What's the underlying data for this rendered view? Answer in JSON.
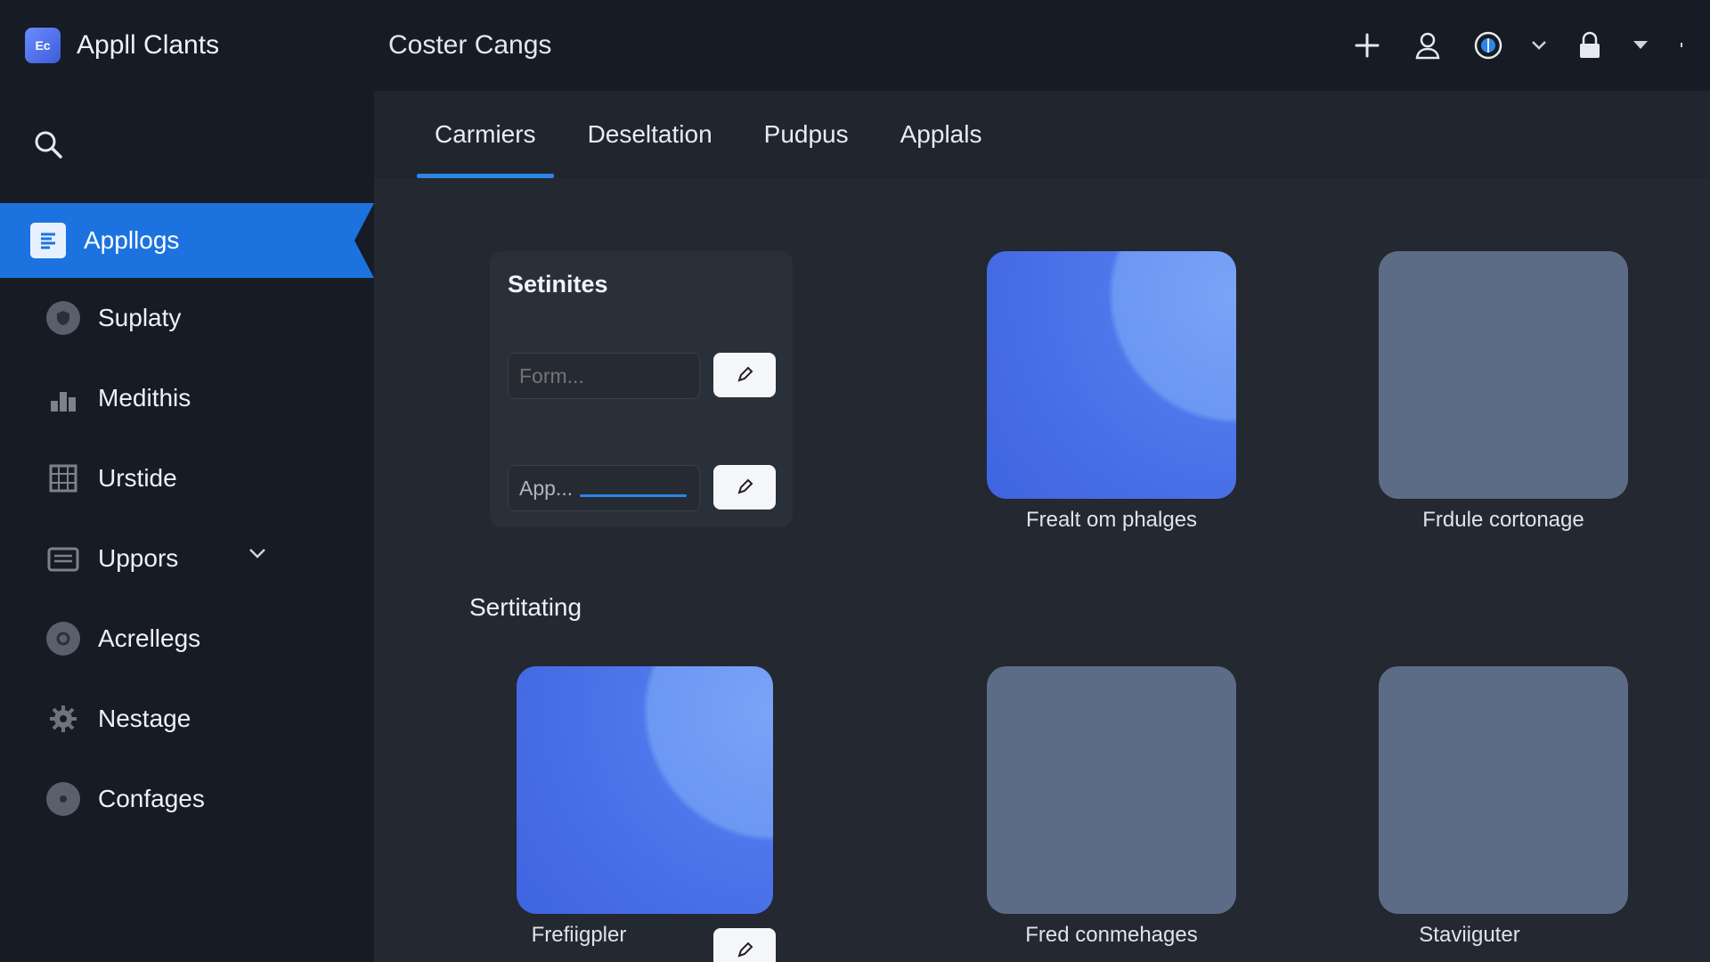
{
  "app": {
    "title": "Appll Clants",
    "logo_text": "Ec",
    "page_title": "Coster Cangs"
  },
  "colors": {
    "accent": "#1c73df",
    "sidebar_bg": "#161b24",
    "main_bg": "#232831",
    "tile_blue": "#4f76ea",
    "tile_grey": "#5d6c86"
  },
  "top_actions": [
    {
      "name": "add-icon"
    },
    {
      "name": "user-icon"
    },
    {
      "name": "globe-icon"
    },
    {
      "name": "lock-icon"
    }
  ],
  "sidebar": {
    "search_icon": "search-icon",
    "items": [
      {
        "label": "Appllogs",
        "icon": "document-icon",
        "active": true
      },
      {
        "label": "Suplaty",
        "icon": "shield-icon"
      },
      {
        "label": "Medithis",
        "icon": "chart-icon"
      },
      {
        "label": "Urstide",
        "icon": "grid-icon"
      },
      {
        "label": "Uppors",
        "icon": "folder-icon",
        "has_chevron": true
      },
      {
        "label": "Acrellegs",
        "icon": "circle-icon"
      },
      {
        "label": "Nestage",
        "icon": "gear-icon"
      },
      {
        "label": "Confages",
        "icon": "disc-icon"
      }
    ]
  },
  "tabs": [
    {
      "label": "Carmiers",
      "active": true
    },
    {
      "label": "Deseltation"
    },
    {
      "label": "Pudpus"
    },
    {
      "label": "Applals"
    }
  ],
  "settings_panel": {
    "title": "Setinites",
    "field_1_placeholder": "Form...",
    "field_2_value": "App..."
  },
  "section_heading": "Sertitating",
  "tiles": [
    {
      "label": "Frealt om phalges",
      "style": "blue"
    },
    {
      "label": "Frdule cortonage",
      "style": "grey"
    },
    {
      "label": "Frefiigpler",
      "style": "blue"
    },
    {
      "label": "Fred conmehages",
      "style": "grey"
    },
    {
      "label": "Staviiguter",
      "style": "grey"
    }
  ]
}
